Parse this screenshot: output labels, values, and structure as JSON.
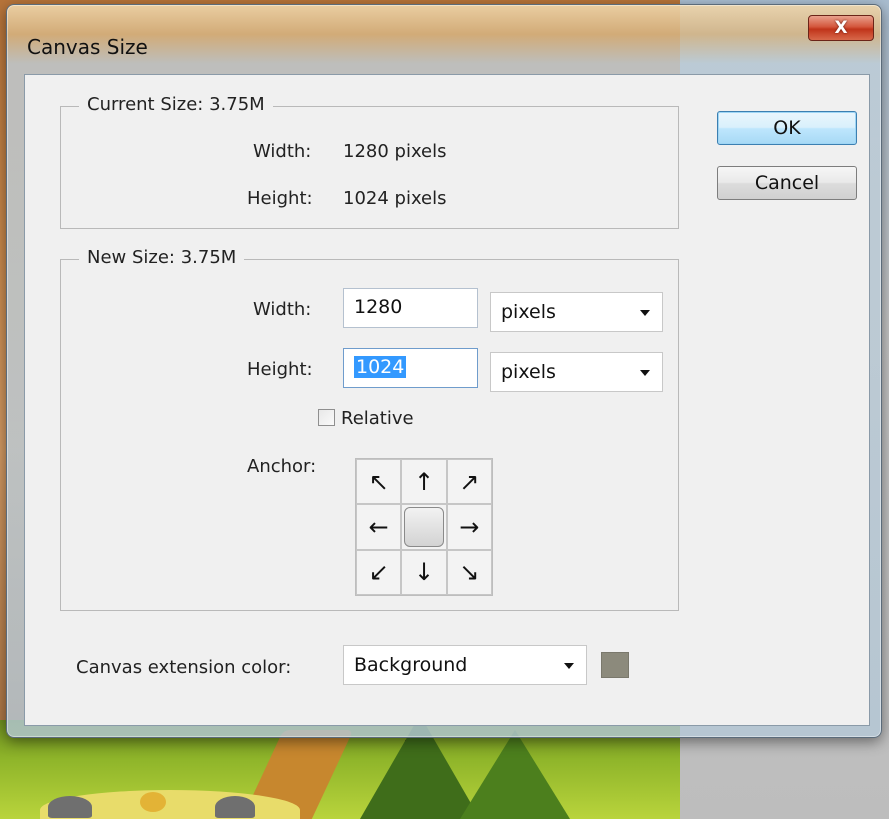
{
  "window": {
    "title": "Canvas Size",
    "close_label": "X"
  },
  "current_size": {
    "legend": "Current Size: 3.75M",
    "width_label": "Width:",
    "width_value": "1280 pixels",
    "height_label": "Height:",
    "height_value": "1024 pixels"
  },
  "new_size": {
    "legend": "New Size: 3.75M",
    "width_label": "Width:",
    "width_value": "1280",
    "width_unit": "pixels",
    "height_label": "Height:",
    "height_value": "1024",
    "height_unit": "pixels",
    "relative_label": "Relative",
    "relative_checked": false,
    "anchor_label": "Anchor:",
    "anchor_arrows": [
      "↖",
      "↑",
      "↗",
      "←",
      "",
      "→",
      "↙",
      "↓",
      "↘"
    ]
  },
  "extension": {
    "label": "Canvas extension color:",
    "value": "Background",
    "swatch_color": "#8c8a7c"
  },
  "buttons": {
    "ok": "OK",
    "cancel": "Cancel"
  }
}
